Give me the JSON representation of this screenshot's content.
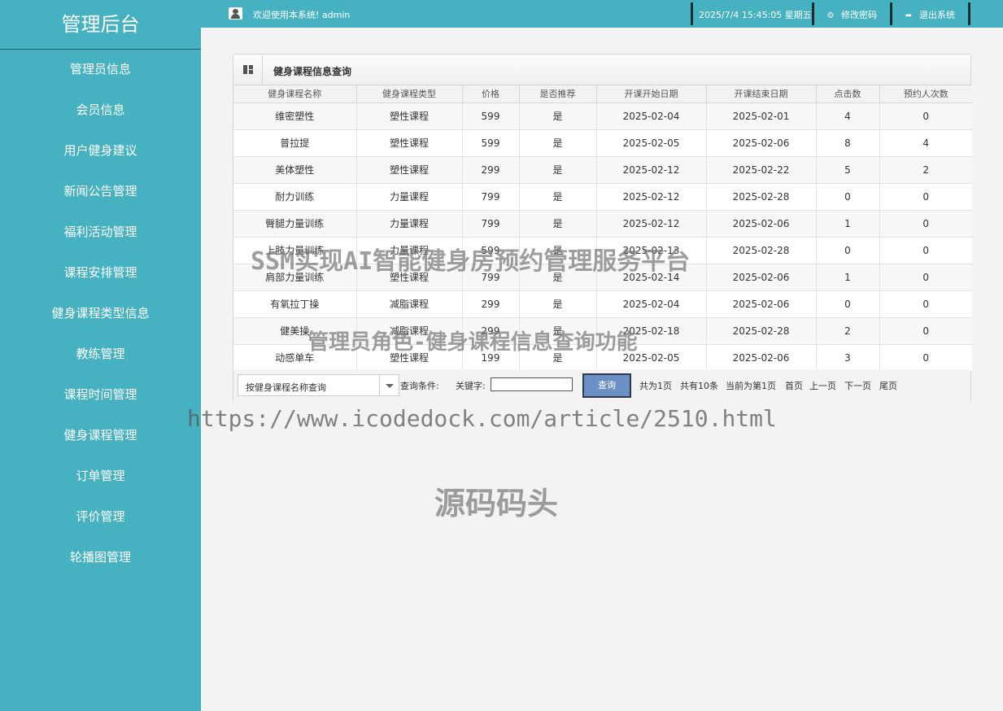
{
  "sidebar": {
    "brand": "管理后台",
    "items": [
      {
        "label": "管理员信息"
      },
      {
        "label": "会员信息"
      },
      {
        "label": "用户健身建议"
      },
      {
        "label": "新闻公告管理"
      },
      {
        "label": "福利活动管理"
      },
      {
        "label": "课程安排管理"
      },
      {
        "label": "健身课程类型信息"
      },
      {
        "label": "教练管理"
      },
      {
        "label": "课程时间管理"
      },
      {
        "label": "健身课程管理"
      },
      {
        "label": "订单管理"
      },
      {
        "label": "评价管理"
      },
      {
        "label": "轮播图管理"
      }
    ]
  },
  "topbar": {
    "welcome": "欢迎使用本系统! admin",
    "datetime": "2025/7/4 15:45:05 星期五",
    "change_password": "修改密码",
    "logout": "退出系统"
  },
  "panel": {
    "title": "健身课程信息查询",
    "columns": [
      "健身课程名称",
      "健身课程类型",
      "价格",
      "是否推荐",
      "开课开始日期",
      "开课结束日期",
      "点击数",
      "预约人次数"
    ],
    "rows": [
      [
        "维密塑性",
        "塑性课程",
        "599",
        "是",
        "2025-02-04",
        "2025-02-01",
        "4",
        "0"
      ],
      [
        "普拉提",
        "塑性课程",
        "599",
        "是",
        "2025-02-05",
        "2025-02-06",
        "8",
        "4"
      ],
      [
        "美体塑性",
        "塑性课程",
        "299",
        "是",
        "2025-02-12",
        "2025-02-22",
        "5",
        "2"
      ],
      [
        "耐力训练",
        "力量课程",
        "799",
        "是",
        "2025-02-12",
        "2025-02-28",
        "0",
        "0"
      ],
      [
        "臀腿力量训练",
        "力量课程",
        "799",
        "是",
        "2025-02-12",
        "2025-02-06",
        "1",
        "0"
      ],
      [
        "上肢力量训练",
        "力量课程",
        "599",
        "是",
        "2025-02-13",
        "2025-02-28",
        "0",
        "0"
      ],
      [
        "肩部力量训练",
        "塑性课程",
        "799",
        "是",
        "2025-02-14",
        "2025-02-06",
        "1",
        "0"
      ],
      [
        "有氧拉丁操",
        "减脂课程",
        "299",
        "是",
        "2025-02-04",
        "2025-02-06",
        "0",
        "0"
      ],
      [
        "健美操",
        "减脂课程",
        "299",
        "是",
        "2025-02-18",
        "2025-02-28",
        "2",
        "0"
      ],
      [
        "动感单车",
        "塑性课程",
        "199",
        "是",
        "2025-02-05",
        "2025-02-06",
        "3",
        "0"
      ]
    ]
  },
  "search": {
    "field_select": "按健身课程名称查询",
    "condition_label": "查询条件:",
    "keyword_label": "关键字:",
    "keyword_value": "",
    "button": "查询"
  },
  "pagination": {
    "total_pages": "共为1页",
    "total_items": "共有10条",
    "current_page": "当前为第1页",
    "first": "首页",
    "prev": "上一页",
    "next": "下一页",
    "last": "尾页"
  },
  "watermarks": {
    "line1": "SSM实现AI智能健身房预约管理服务平台",
    "line2": "管理员角色-健身课程信息查询功能",
    "url": "https://www.icodedock.com/article/2510.html",
    "brand": "源码码头"
  }
}
